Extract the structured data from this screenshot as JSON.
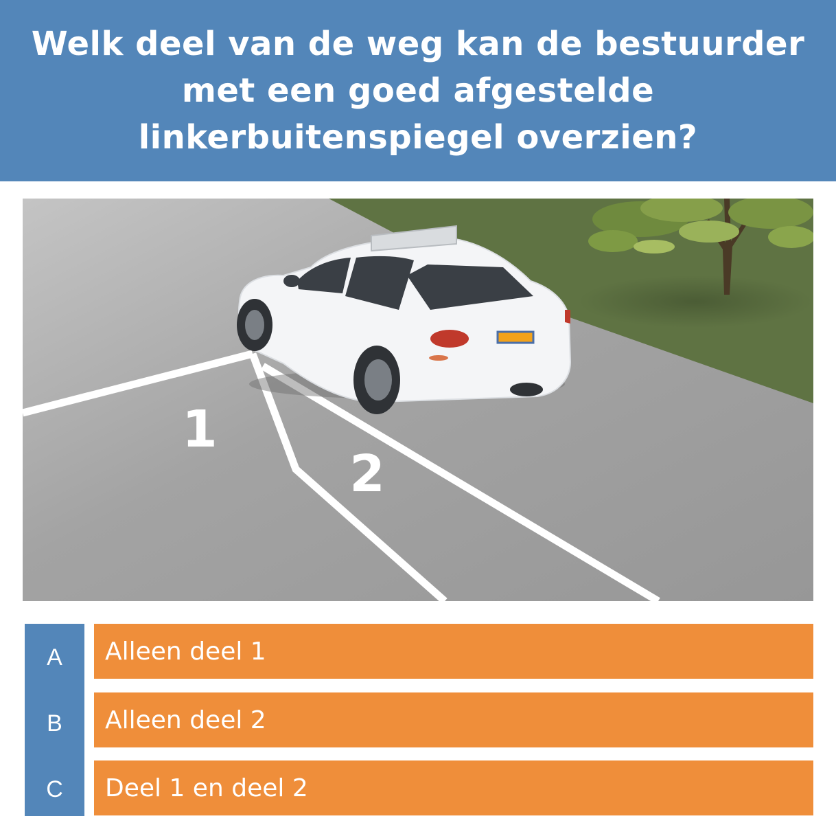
{
  "question": {
    "lines": [
      "Welk deel van de weg kan de bestuurder",
      "met een goed afgestelde",
      "linkerbuitenspiegel overzien?"
    ]
  },
  "scene": {
    "zone_labels": [
      "1",
      "2"
    ],
    "colors": {
      "road": "#9a9a9a",
      "grass": "#5f7343",
      "car": "#f4f5f7",
      "lines": "#ffffff"
    },
    "icons": [
      "car-icon",
      "tree-icon"
    ]
  },
  "answers": [
    {
      "letter": "A",
      "text": "Alleen deel 1"
    },
    {
      "letter": "B",
      "text": "Alleen deel 2"
    },
    {
      "letter": "C",
      "text": "Deel 1 en deel 2"
    }
  ],
  "colors": {
    "header": "#5386b9",
    "option": "#ef8e3a",
    "letter_column": "#5386b9"
  }
}
